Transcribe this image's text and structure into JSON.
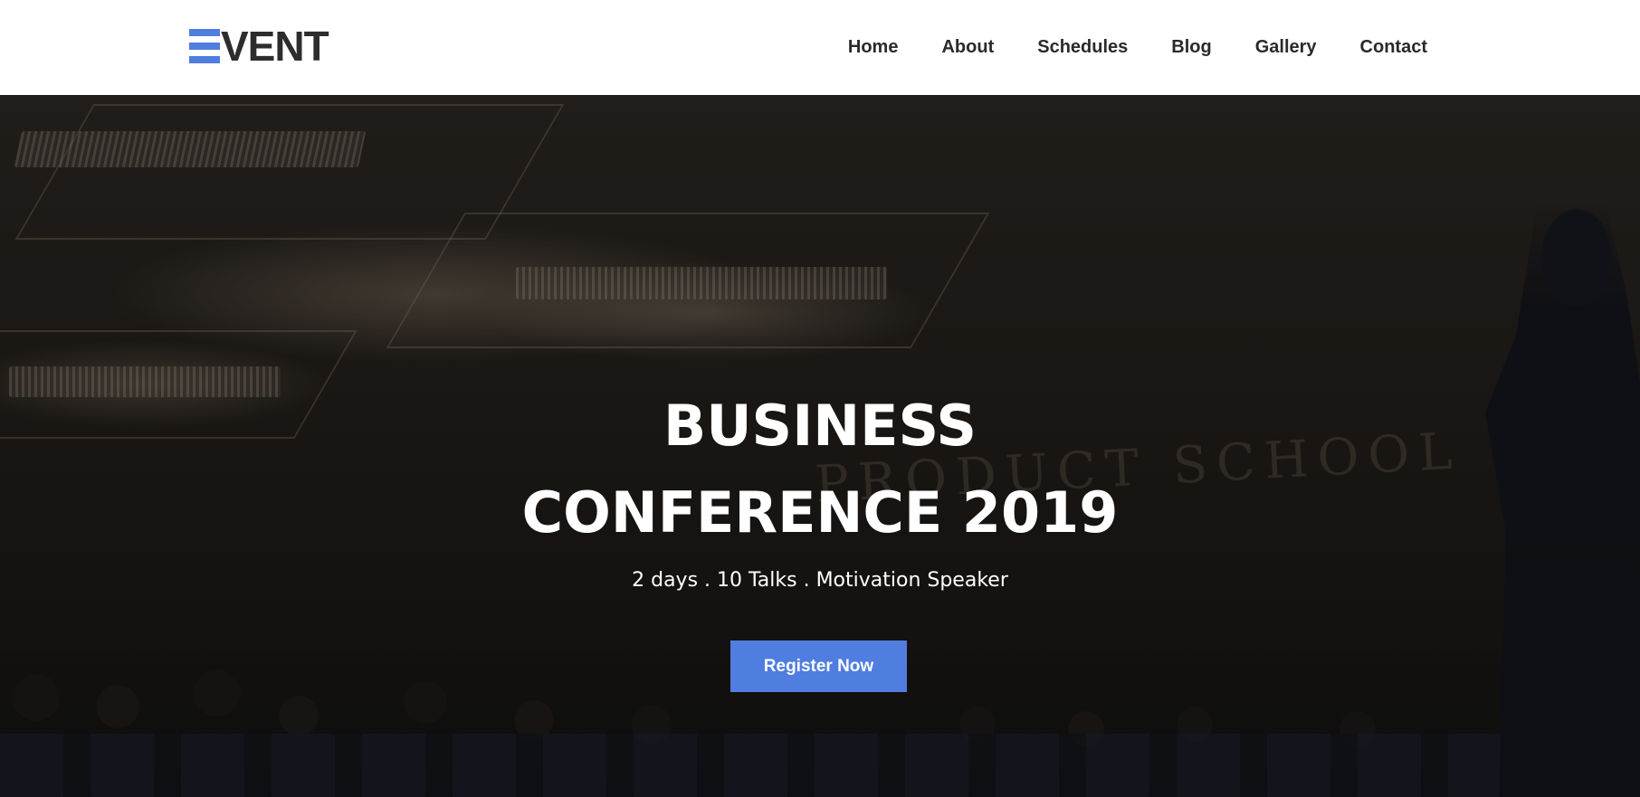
{
  "brand": {
    "logo_text": "VENT",
    "accent_color": "#4f7de0"
  },
  "nav": {
    "items": [
      {
        "label": "Home"
      },
      {
        "label": "About"
      },
      {
        "label": "Schedules"
      },
      {
        "label": "Blog"
      },
      {
        "label": "Gallery"
      },
      {
        "label": "Contact"
      }
    ]
  },
  "hero": {
    "title_line1": "BUSINESS",
    "title_line2": "CONFERENCE 2019",
    "subtitle": "2 days . 10 Talks . Motivation Speaker",
    "cta_label": "Register Now",
    "background_wall_text": "PRODUCT SCHOOL"
  }
}
